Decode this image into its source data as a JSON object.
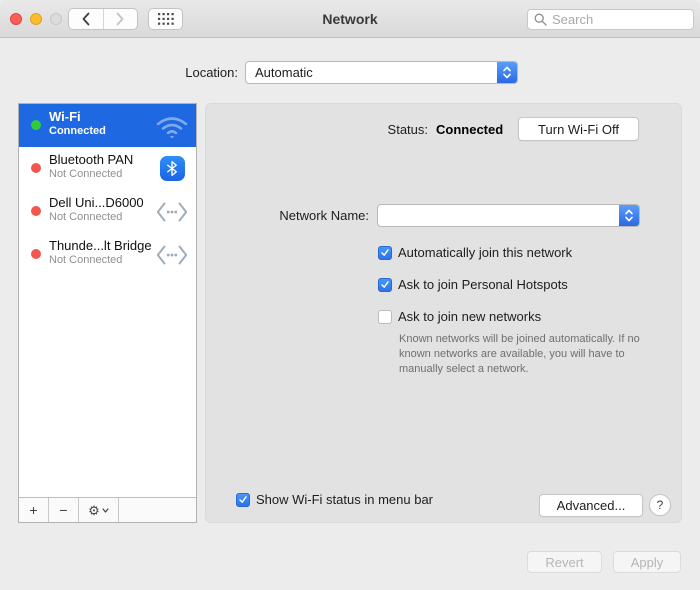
{
  "window": {
    "title": "Network"
  },
  "titlebar": {
    "search_placeholder": "Search",
    "icons": [
      "close-icon",
      "minimize-icon",
      "zoom-icon",
      "back-chevron-icon",
      "forward-chevron-icon",
      "show-all-grid-icon",
      "search-icon"
    ]
  },
  "location": {
    "label": "Location:",
    "value": "Automatic"
  },
  "sidebar": {
    "items": [
      {
        "name": "Wi-Fi",
        "status": "Connected",
        "icon": "wifi-icon",
        "dot_color": "#30cb3c",
        "selected": true
      },
      {
        "name": "Bluetooth PAN",
        "status": "Not Connected",
        "icon": "bluetooth-icon",
        "dot_color": "#f2564e",
        "selected": false
      },
      {
        "name": "Dell Uni...D6000",
        "status": "Not Connected",
        "icon": "ethernet-adapter-icon",
        "dot_color": "#f2564e",
        "selected": false
      },
      {
        "name": "Thunde...lt Bridge",
        "status": "Not Connected",
        "icon": "ethernet-adapter-icon",
        "dot_color": "#f2564e",
        "selected": false
      }
    ],
    "toolbar": {
      "add_label": "+",
      "remove_label": "−",
      "action_icon": "gear-icon",
      "action_glyph": "⚙"
    }
  },
  "panel": {
    "status_label": "Status:",
    "status_value": "Connected",
    "turn_off_button": "Turn Wi-Fi Off",
    "network_name_label": "Network Name:",
    "network_name_value": "",
    "checkboxes": [
      {
        "label": "Automatically join this network",
        "checked": true
      },
      {
        "label": "Ask to join Personal Hotspots",
        "checked": true
      },
      {
        "label": "Ask to join new networks",
        "checked": false
      }
    ],
    "helper_text": "Known networks will be joined automatically. If no known networks are available, you will have to manually select a network.",
    "menubar_checkbox": {
      "label": "Show Wi-Fi status in menu bar",
      "checked": true
    },
    "advanced_button": "Advanced...",
    "help_button": "?"
  },
  "footer": {
    "revert_button": "Revert",
    "apply_button": "Apply"
  },
  "colors": {
    "selection_blue": "#1e68e2",
    "checkbox_blue": "#3d87f5",
    "popup_cap_blue": "#2a69e4",
    "connected_green": "#30cb3c",
    "disconnected_red": "#f2564e",
    "panel_gray": "#e2e2e2",
    "window_gray": "#ececec"
  }
}
